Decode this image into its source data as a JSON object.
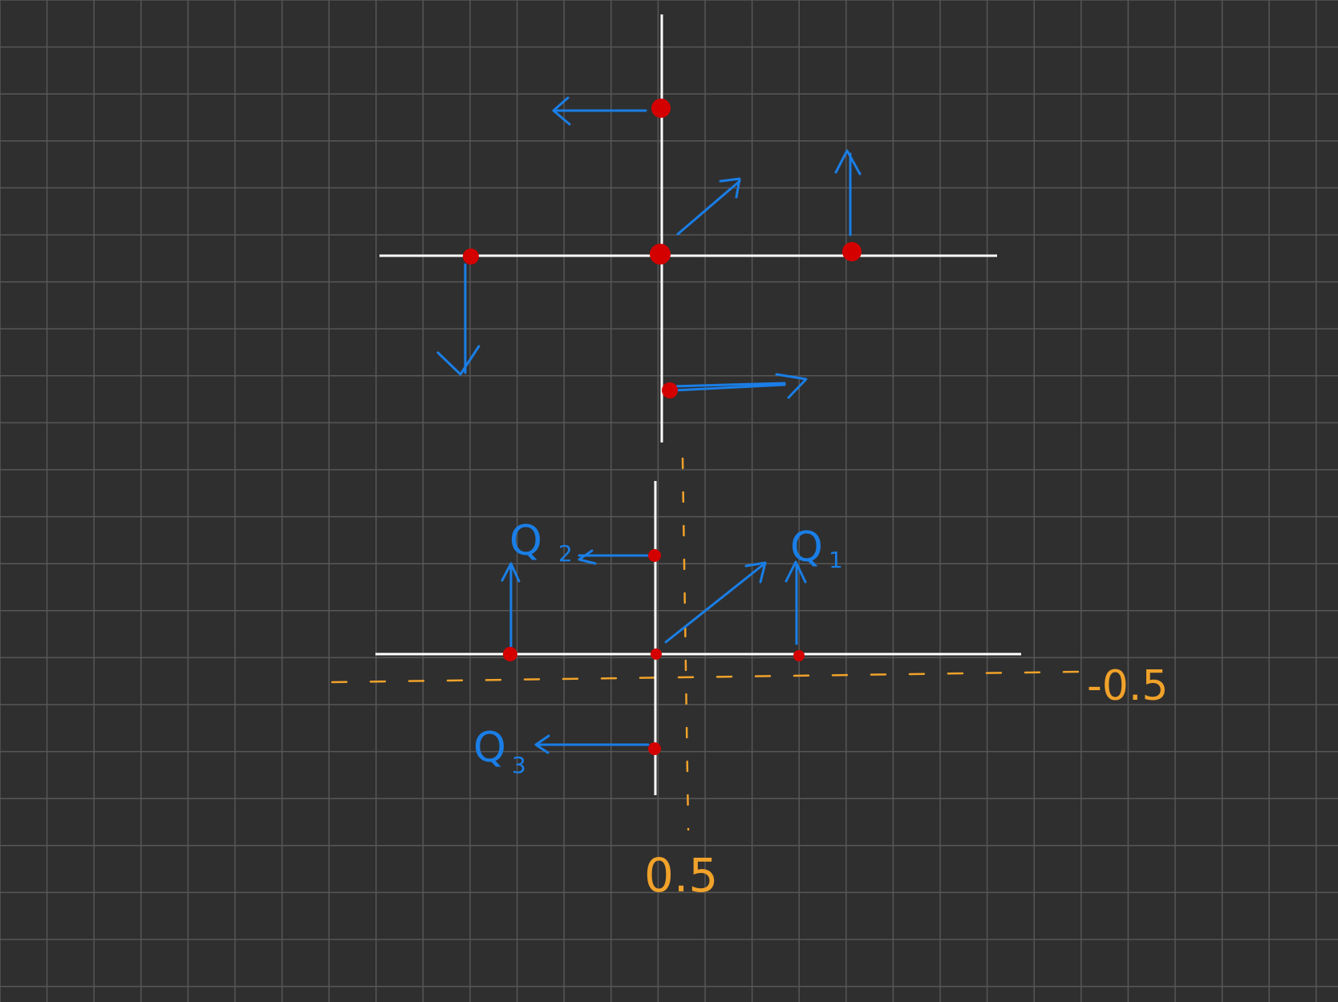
{
  "colors": {
    "background": "#2f2f2f",
    "grid": "#5a5a5a",
    "axis": "#ffffff",
    "point": "#d40000",
    "arrow": "#1a7ee6",
    "guide": "#f0a22a"
  },
  "labels": {
    "q1": "Q",
    "q1_sub": "1",
    "q2": "Q",
    "q2_sub": "2",
    "q3": "Q",
    "q3_sub": "3",
    "vertical_guide_value": "0.5",
    "horizontal_guide_value": "-0.5"
  }
}
